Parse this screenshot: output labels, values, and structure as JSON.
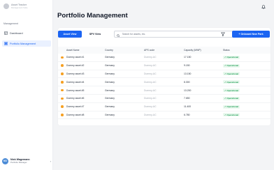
{
  "sidebar": {
    "brand": {
      "name": "Asset Tracker",
      "sub": "Management Suite"
    },
    "section_label": "Management",
    "items": [
      {
        "label": "Dashboard",
        "icon": "dashboard-icon",
        "active": false
      },
      {
        "label": "Portfolio Management",
        "icon": "portfolio-icon",
        "active": true
      }
    ],
    "user": {
      "initials": "NO",
      "name": "Nick Wagemann",
      "role": "Portfolio Manager"
    }
  },
  "header": {
    "title": "Portfolio Management",
    "bell_icon": "bell-icon"
  },
  "toolbar": {
    "tabs": [
      {
        "label": "Asset View",
        "active": true
      },
      {
        "label": "SPV View",
        "active": false
      }
    ],
    "search_placeholder": "Search for assets, etc.",
    "filter_icon": "filter-icon",
    "onboard_label": "+ Onboard New Park"
  },
  "table": {
    "columns": [
      "Asset Name",
      "Country",
      "APS code",
      "Capacity (MWP)",
      "Status"
    ],
    "rows": [
      {
        "name": "Dummy asset #1",
        "country": "Germany",
        "code": "Dummy-AC",
        "capacity": "17.150",
        "status": "Operational"
      },
      {
        "name": "Dummy asset #2",
        "country": "Germany",
        "code": "Dummy-AC",
        "capacity": "9.150",
        "status": "Operational"
      },
      {
        "name": "Dummy asset #3",
        "country": "Germany",
        "code": "Dummy-AC",
        "capacity": "13.150",
        "status": "Operational"
      },
      {
        "name": "Dummy asset #4",
        "country": "Germany",
        "code": "Dummy-AC",
        "capacity": "8.300",
        "status": "Operational"
      },
      {
        "name": "Dummy asset #5",
        "country": "Germany",
        "code": "Dummy-AC",
        "capacity": "13.200",
        "status": "Operational"
      },
      {
        "name": "Dummy asset #6",
        "country": "Germany",
        "code": "Dummy-AC",
        "capacity": "7.650",
        "status": "Operational"
      },
      {
        "name": "Dummy asset #7",
        "country": "Germany",
        "code": "Dummy-AC",
        "capacity": "11.400",
        "status": "Operational"
      },
      {
        "name": "Dummy asset #8",
        "country": "Germany",
        "code": "Dummy-AC",
        "capacity": "6.780",
        "status": "Operational"
      }
    ]
  },
  "colors": {
    "accent": "#1b64f2",
    "status_ok": "#1f9d55",
    "row_dot": "#f5a023"
  }
}
